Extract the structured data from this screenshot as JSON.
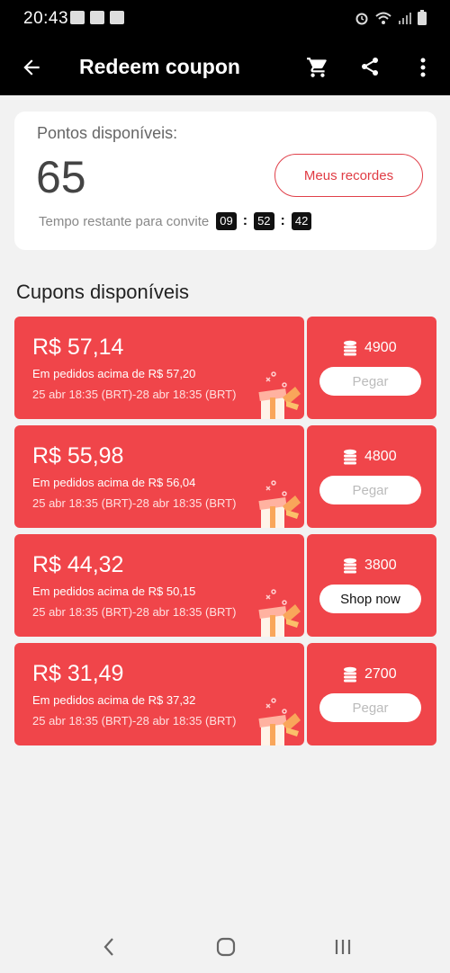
{
  "status": {
    "time": "20:43"
  },
  "header": {
    "title": "Redeem coupon"
  },
  "points": {
    "label": "Pontos disponíveis:",
    "value": "65",
    "records_button": "Meus recordes",
    "timer_label": "Tempo restante para convite",
    "timer": {
      "hours": "09",
      "minutes": "52",
      "seconds": "42"
    }
  },
  "coupons_title": "Cupons disponíveis",
  "coupons": [
    {
      "amount": "R$ 57,14",
      "condition": "Em pedidos acima de R$ 57,20",
      "validity": "25 abr 18:35 (BRT)-28 abr 18:35 (BRT)",
      "points": "4900",
      "action": "Pegar",
      "enabled": false
    },
    {
      "amount": "R$ 55,98",
      "condition": "Em pedidos acima de R$ 56,04",
      "validity": "25 abr 18:35 (BRT)-28 abr 18:35 (BRT)",
      "points": "4800",
      "action": "Pegar",
      "enabled": false
    },
    {
      "amount": "R$ 44,32",
      "condition": "Em pedidos acima de R$ 50,15",
      "validity": "25 abr 18:35 (BRT)-28 abr 18:35 (BRT)",
      "points": "3800",
      "action": "Shop now",
      "enabled": true
    },
    {
      "amount": "R$ 31,49",
      "condition": "Em pedidos acima de R$ 37,32",
      "validity": "25 abr 18:35 (BRT)-28 abr 18:35 (BRT)",
      "points": "2700",
      "action": "Pegar",
      "enabled": false
    }
  ],
  "colors": {
    "accent": "#f0454a",
    "header_bg": "#000000",
    "page_bg": "#f2f2f2"
  },
  "icons": [
    "back-arrow-icon",
    "cart-icon",
    "share-icon",
    "more-vert-icon",
    "coin-stack-icon",
    "gift-box-icon",
    "nav-back-icon",
    "nav-home-icon",
    "nav-recents-icon"
  ]
}
